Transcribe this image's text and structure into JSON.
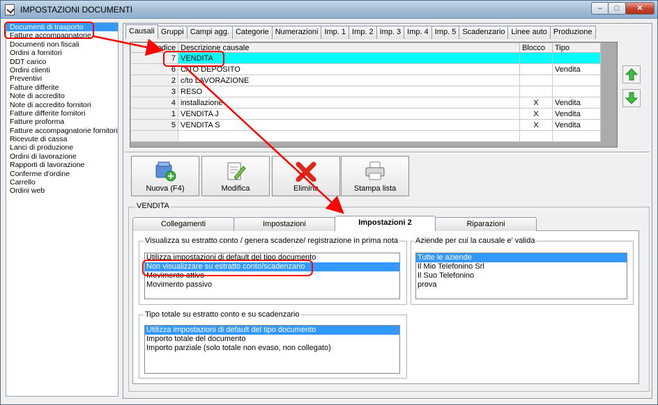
{
  "window": {
    "title": "IMPOSTAZIONI DOCUMENTI",
    "buttons": {
      "minimize": "–",
      "maximize": "□",
      "close": "✕"
    }
  },
  "left_list": {
    "items": [
      "Documenti di trasporto",
      "Fatture accompagnatorie",
      "Documenti non fiscali",
      "Ordini a fornitori",
      "DDT carico",
      "Ordini clienti",
      "Preventivi",
      "Fatture differite",
      "Note di accredito",
      "Note di accredito fornitori",
      "Fatture differite fornitori",
      "Fatture proforma",
      "Fatture accompagnatorie fornitori",
      "Ricevute di cassa",
      "Lanci di produzione",
      "Ordini di lavorazione",
      "Rapporti di lavorazione",
      "Conferme d'ordine",
      "Carrello",
      "Ordini web"
    ],
    "selected_index": 0
  },
  "top_tabs": [
    "Causali",
    "Gruppi",
    "Campi agg.",
    "Categorie",
    "Numerazioni",
    "Imp. 1",
    "Imp. 2",
    "Imp. 3",
    "Imp. 4",
    "Imp. 5",
    "Scadenzario",
    "Linee auto",
    "Produzione"
  ],
  "grid": {
    "headers": [
      "Codice",
      "Descrizione causale",
      "Blocco",
      "Tipo"
    ],
    "rows": [
      {
        "code": "7",
        "desc": "VENDITA",
        "block": "",
        "type": ""
      },
      {
        "code": "6",
        "desc": "C/TO DEPOSITO",
        "block": "",
        "type": "Vendita"
      },
      {
        "code": "2",
        "desc": "c/to LAVORAZIONE",
        "block": "",
        "type": ""
      },
      {
        "code": "3",
        "desc": "RESO",
        "block": "",
        "type": ""
      },
      {
        "code": "4",
        "desc": "installazione",
        "block": "X",
        "type": "Vendita"
      },
      {
        "code": "1",
        "desc": "VENDITA J",
        "block": "X",
        "type": "Vendita"
      },
      {
        "code": "5",
        "desc": "VENDITA S",
        "block": "X",
        "type": "Vendita"
      }
    ]
  },
  "toolbar": {
    "new": "Nuova (F4)",
    "edit": "Modifica",
    "delete": "Elimina",
    "print": "Stampa lista"
  },
  "group_title": "VENDITA",
  "inner_tabs": [
    "Collegamenti",
    "Impostazioni",
    "Impostazioni 2",
    "Riparazioni"
  ],
  "estratto": {
    "legend": "Visualizza su estratto conto / genera scadenze/ registrazione  in prima nota",
    "options": [
      "Utilizza impostazioni di default del tipo documento",
      "Non visualizzare su estratto conto/scadenzario",
      "Movimento attivo",
      "Movimento passivo"
    ],
    "selected_index": 1
  },
  "aziende": {
    "legend": "Aziende per cui la causale e' valida",
    "options": [
      "Tutte le aziende",
      "Il Mio Telefonino Srl",
      "Il Suo Telefonino",
      "prova"
    ],
    "selected_index": 0
  },
  "tipo_totale": {
    "legend": "Tipo totale su estratto conto e su scadenzario",
    "options": [
      "Utilizza impostazioni di default del tipo documento",
      "Importo totale del documento",
      "Importo parziale (solo totale non evaso, non collegato)"
    ],
    "selected_index": 0
  },
  "colors": {
    "selection": "#3399ff",
    "grid_selected_row": "#00ffff",
    "annotation": "#ff0000"
  }
}
